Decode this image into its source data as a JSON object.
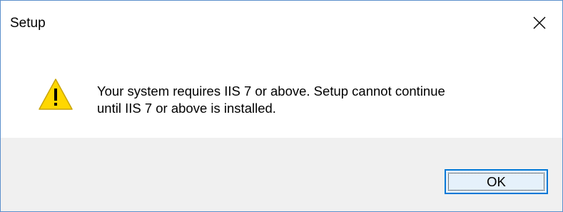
{
  "window": {
    "title": "Setup",
    "close_icon": "close-icon"
  },
  "message": {
    "icon": "warning-icon",
    "line1": "Your system requires IIS 7 or above. Setup cannot continue",
    "line2": "until IIS 7 or above is installed."
  },
  "buttons": {
    "ok_label": "OK"
  },
  "colors": {
    "border": "#5c8fcc",
    "footer_bg": "#f0f0f0",
    "button_border": "#0078d7",
    "button_bg": "#e5f1fb",
    "warning_fill": "#ffd700"
  }
}
